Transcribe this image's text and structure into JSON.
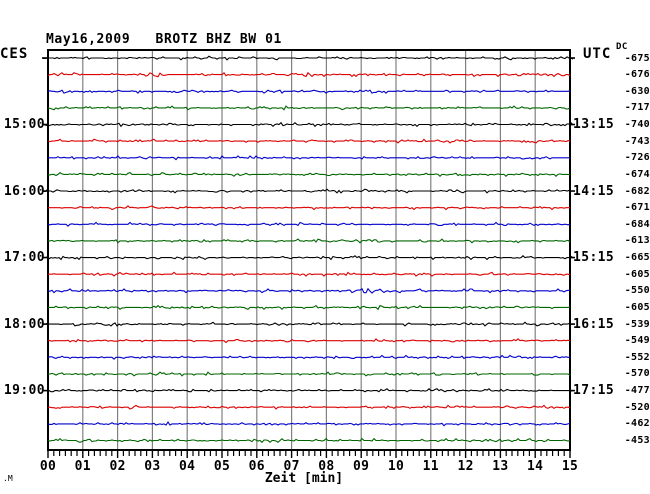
{
  "header": {
    "title": "May16,2009   BROTZ BHZ BW 01",
    "left_timezone": "CES",
    "right_timezone": "UTC",
    "dc_label": "DC"
  },
  "x_axis": {
    "label": "Zeit [min]",
    "tick_labels": [
      "00",
      "01",
      "02",
      "03",
      "04",
      "05",
      "06",
      "07",
      "08",
      "09",
      "10",
      "11",
      "12",
      "13",
      "14",
      "15"
    ]
  },
  "watermark": ".M",
  "colors": {
    "black": "#000000",
    "red": "#dd0000",
    "blue": "#0000cc",
    "green": "#006600",
    "grid": "#808080",
    "background": "#ffffff"
  },
  "chart_data": {
    "type": "line",
    "subtype": "helicorder-seismogram",
    "title": "May16,2009   BROTZ BHZ BW 01",
    "date": "May16,2009",
    "station": "BROTZ BHZ BW 01",
    "xlabel": "Zeit [min]",
    "x_range_minutes": [
      0,
      15
    ],
    "minutes_per_line": 15,
    "grid": "vertical-every-minute",
    "left_time_labels": [
      {
        "row": 4,
        "label": "15:00"
      },
      {
        "row": 8,
        "label": "16:00"
      },
      {
        "row": 12,
        "label": "17:00"
      },
      {
        "row": 16,
        "label": "18:00"
      },
      {
        "row": 20,
        "label": "19:00"
      }
    ],
    "right_time_labels": [
      {
        "row": 4,
        "label": "13:15"
      },
      {
        "row": 8,
        "label": "14:15"
      },
      {
        "row": 12,
        "label": "15:15"
      },
      {
        "row": 16,
        "label": "16:15"
      },
      {
        "row": 20,
        "label": "17:15"
      }
    ],
    "traces": [
      {
        "row": 0,
        "color": "black",
        "dc": "-675"
      },
      {
        "row": 1,
        "color": "red",
        "dc": "-676"
      },
      {
        "row": 2,
        "color": "blue",
        "dc": "-630"
      },
      {
        "row": 3,
        "color": "green",
        "dc": "-717"
      },
      {
        "row": 4,
        "color": "black",
        "dc": "-740"
      },
      {
        "row": 5,
        "color": "red",
        "dc": "-743"
      },
      {
        "row": 6,
        "color": "blue",
        "dc": "-726"
      },
      {
        "row": 7,
        "color": "green",
        "dc": "-674"
      },
      {
        "row": 8,
        "color": "black",
        "dc": "-682"
      },
      {
        "row": 9,
        "color": "red",
        "dc": "-671"
      },
      {
        "row": 10,
        "color": "blue",
        "dc": "-684"
      },
      {
        "row": 11,
        "color": "green",
        "dc": "-613"
      },
      {
        "row": 12,
        "color": "black",
        "dc": "-665"
      },
      {
        "row": 13,
        "color": "red",
        "dc": "-605"
      },
      {
        "row": 14,
        "color": "blue",
        "dc": "-550"
      },
      {
        "row": 15,
        "color": "green",
        "dc": "-605"
      },
      {
        "row": 16,
        "color": "black",
        "dc": "-539"
      },
      {
        "row": 17,
        "color": "red",
        "dc": "-549"
      },
      {
        "row": 18,
        "color": "blue",
        "dc": "-552"
      },
      {
        "row": 19,
        "color": "green",
        "dc": "-570"
      },
      {
        "row": 20,
        "color": "black",
        "dc": "-477"
      },
      {
        "row": 21,
        "color": "red",
        "dc": "-520"
      },
      {
        "row": 22,
        "color": "blue",
        "dc": "-462"
      },
      {
        "row": 23,
        "color": "green",
        "dc": "-453"
      }
    ],
    "noise_bursts": [
      {
        "row": 1,
        "start_min": 2.8,
        "end_min": 3.4
      },
      {
        "row": 14,
        "start_min": 8.6,
        "end_min": 9.8
      }
    ]
  }
}
